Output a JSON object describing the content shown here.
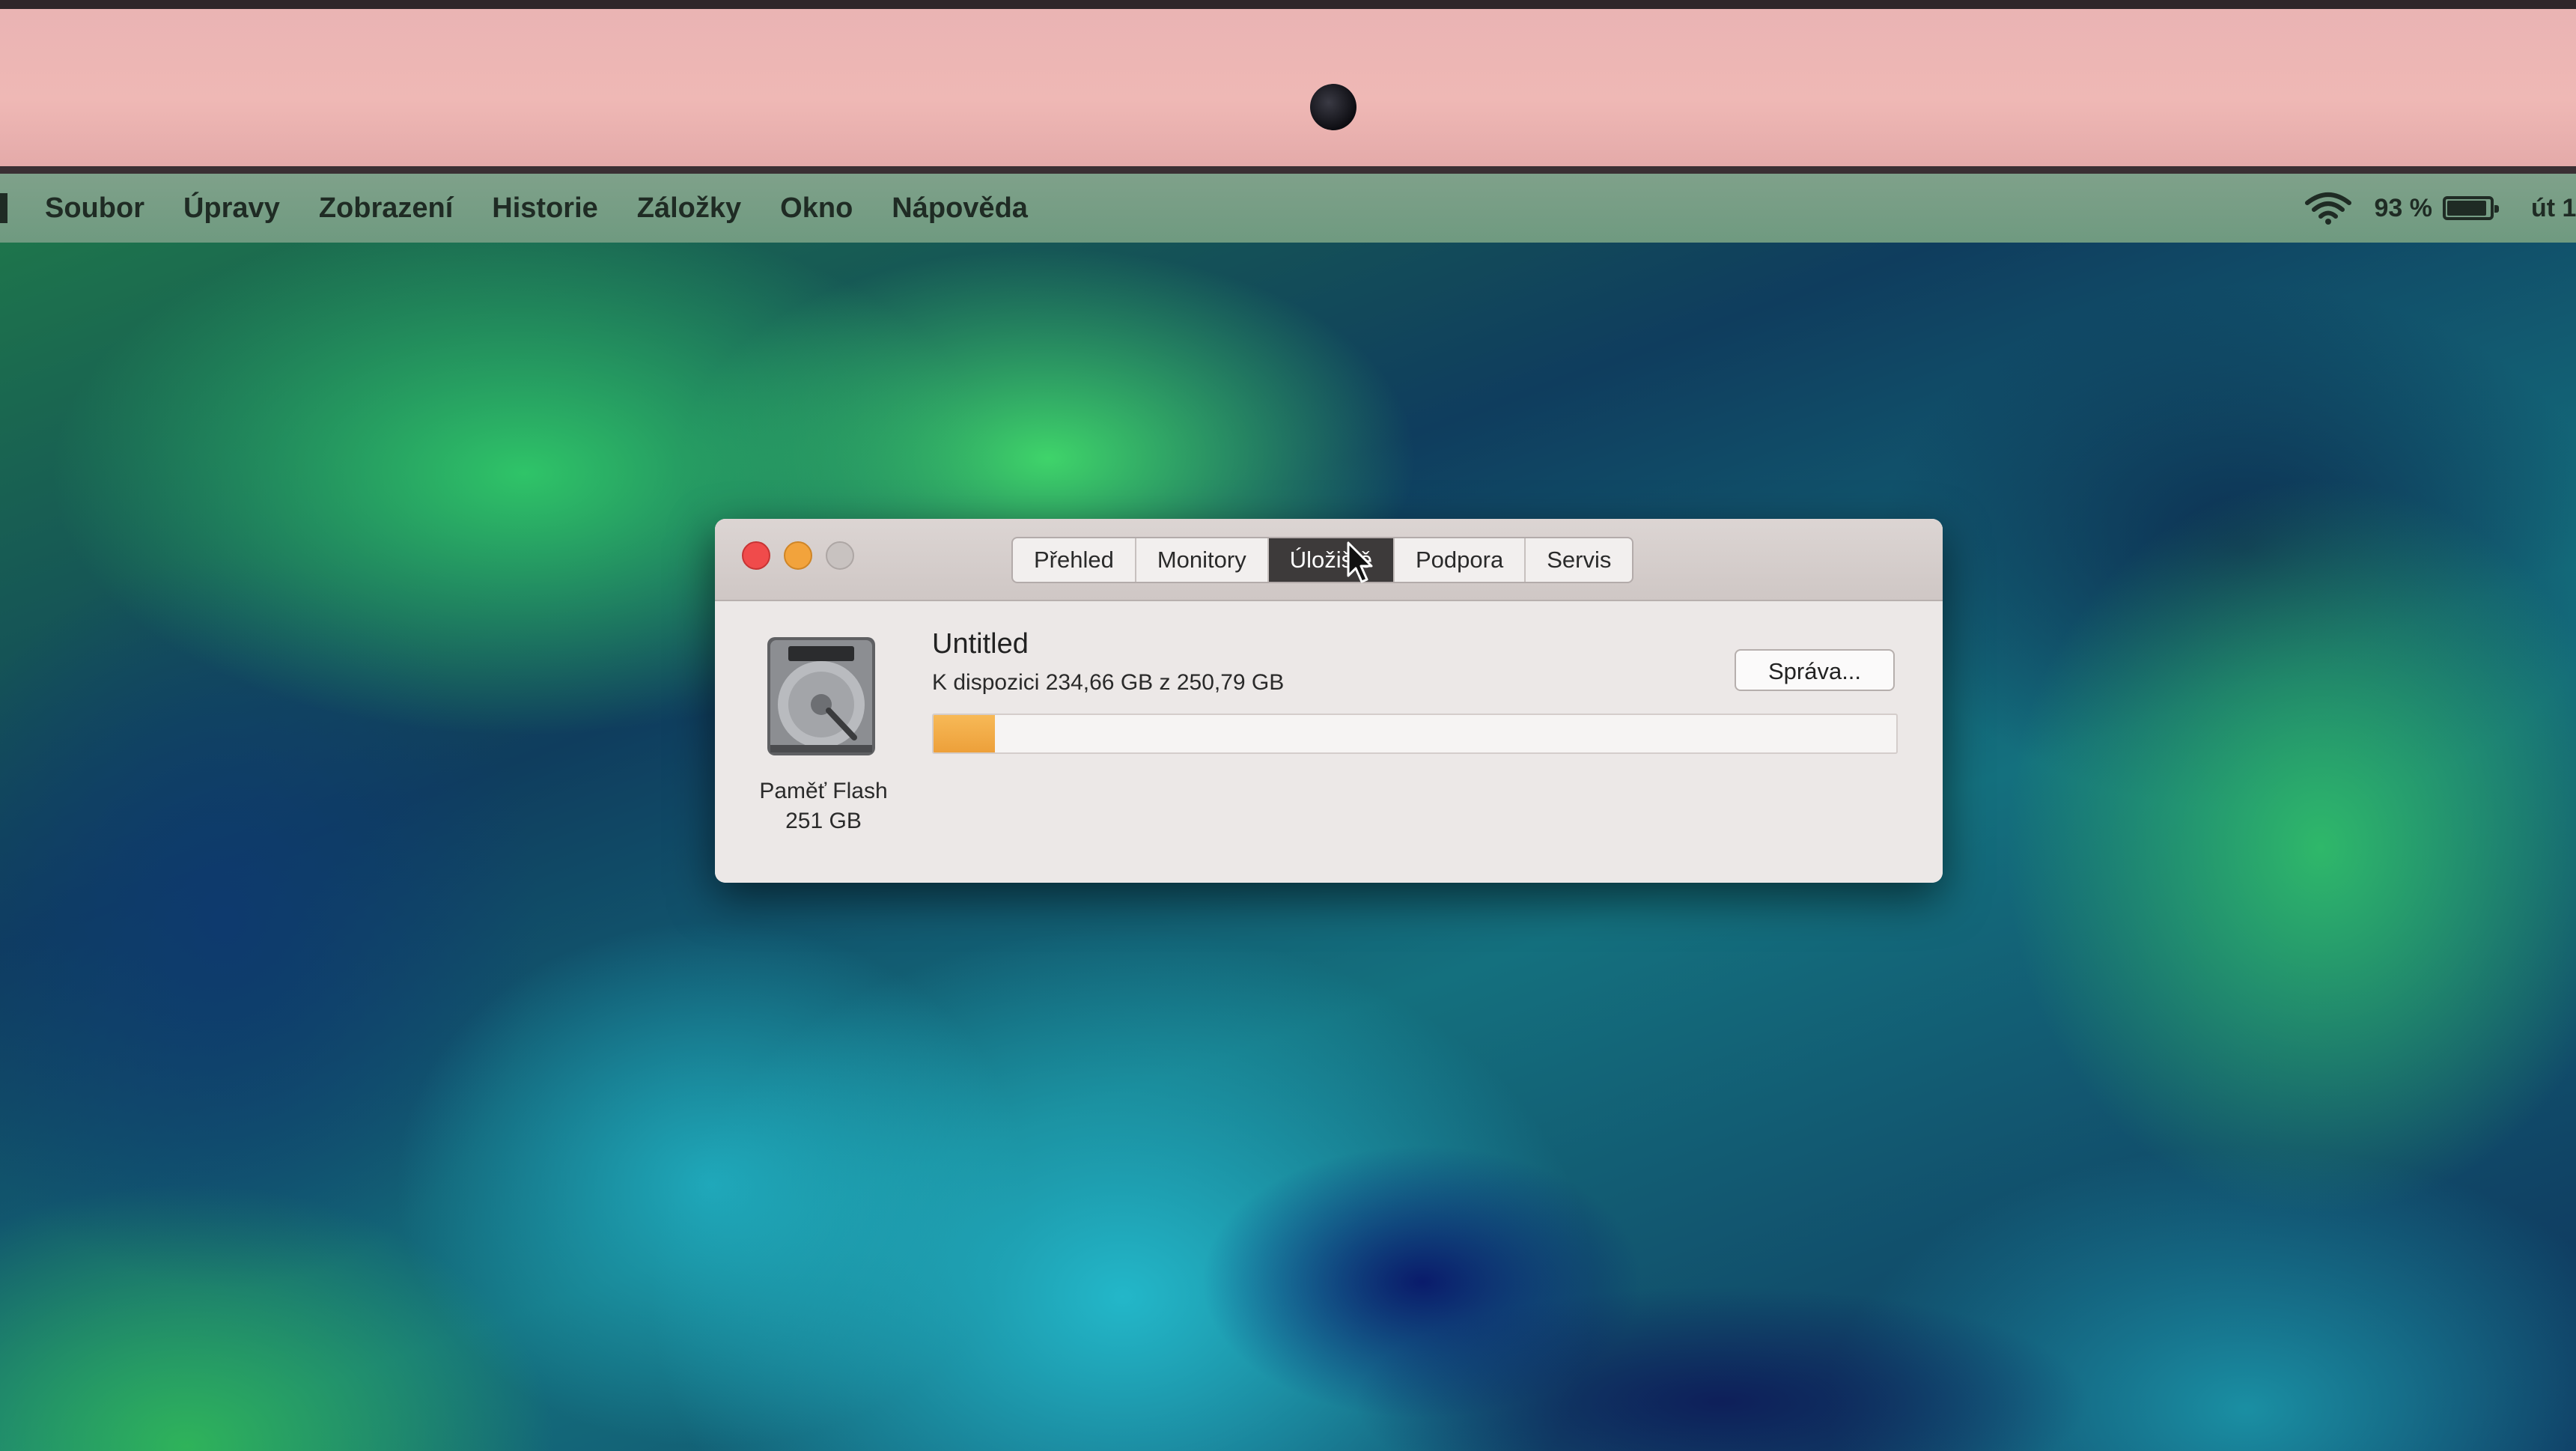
{
  "menubar": {
    "items": [
      "Soubor",
      "Úpravy",
      "Zobrazení",
      "Historie",
      "Záložky",
      "Okno",
      "Nápověda"
    ],
    "battery_percent_label": "93 %",
    "battery_level": 0.93,
    "clock_partial": "út 1"
  },
  "window": {
    "tabs": [
      {
        "label": "Přehled",
        "active": false
      },
      {
        "label": "Monitory",
        "active": false
      },
      {
        "label": "Úložiště",
        "active": true
      },
      {
        "label": "Podpora",
        "active": false
      },
      {
        "label": "Servis",
        "active": false
      }
    ],
    "disk": {
      "icon": "hard-drive-icon",
      "name_line1": "Paměť Flash",
      "name_line2": "251 GB"
    },
    "volume": {
      "title": "Untitled",
      "availability": "K dispozici 234,66 GB z 250,79 GB",
      "used_fraction": 0.064
    },
    "manage_button": "Správa..."
  },
  "colors": {
    "close": "#f04b4b",
    "minimize": "#f2a33c",
    "zoom_inactive": "#c8c2c0",
    "storage_used": "#eda03a",
    "active_tab_bg": "#3d3a3a"
  }
}
